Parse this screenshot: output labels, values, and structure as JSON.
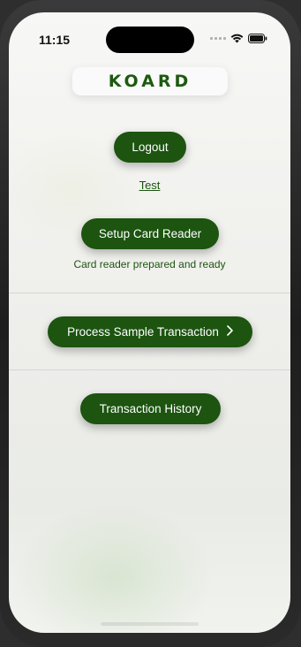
{
  "status_bar": {
    "time": "11:15"
  },
  "logo": {
    "text": "KOARD"
  },
  "buttons": {
    "logout": "Logout",
    "test_link": "Test",
    "setup_card_reader": "Setup Card Reader",
    "process_sample_transaction": "Process Sample Transaction",
    "transaction_history": "Transaction History"
  },
  "card_reader_status": "Card reader prepared and ready",
  "colors": {
    "brand_green": "#1c5410",
    "background": "#f2f3f0"
  },
  "icons": [
    "signal-icon",
    "wifi-icon",
    "battery-icon",
    "chevron-right-icon"
  ]
}
